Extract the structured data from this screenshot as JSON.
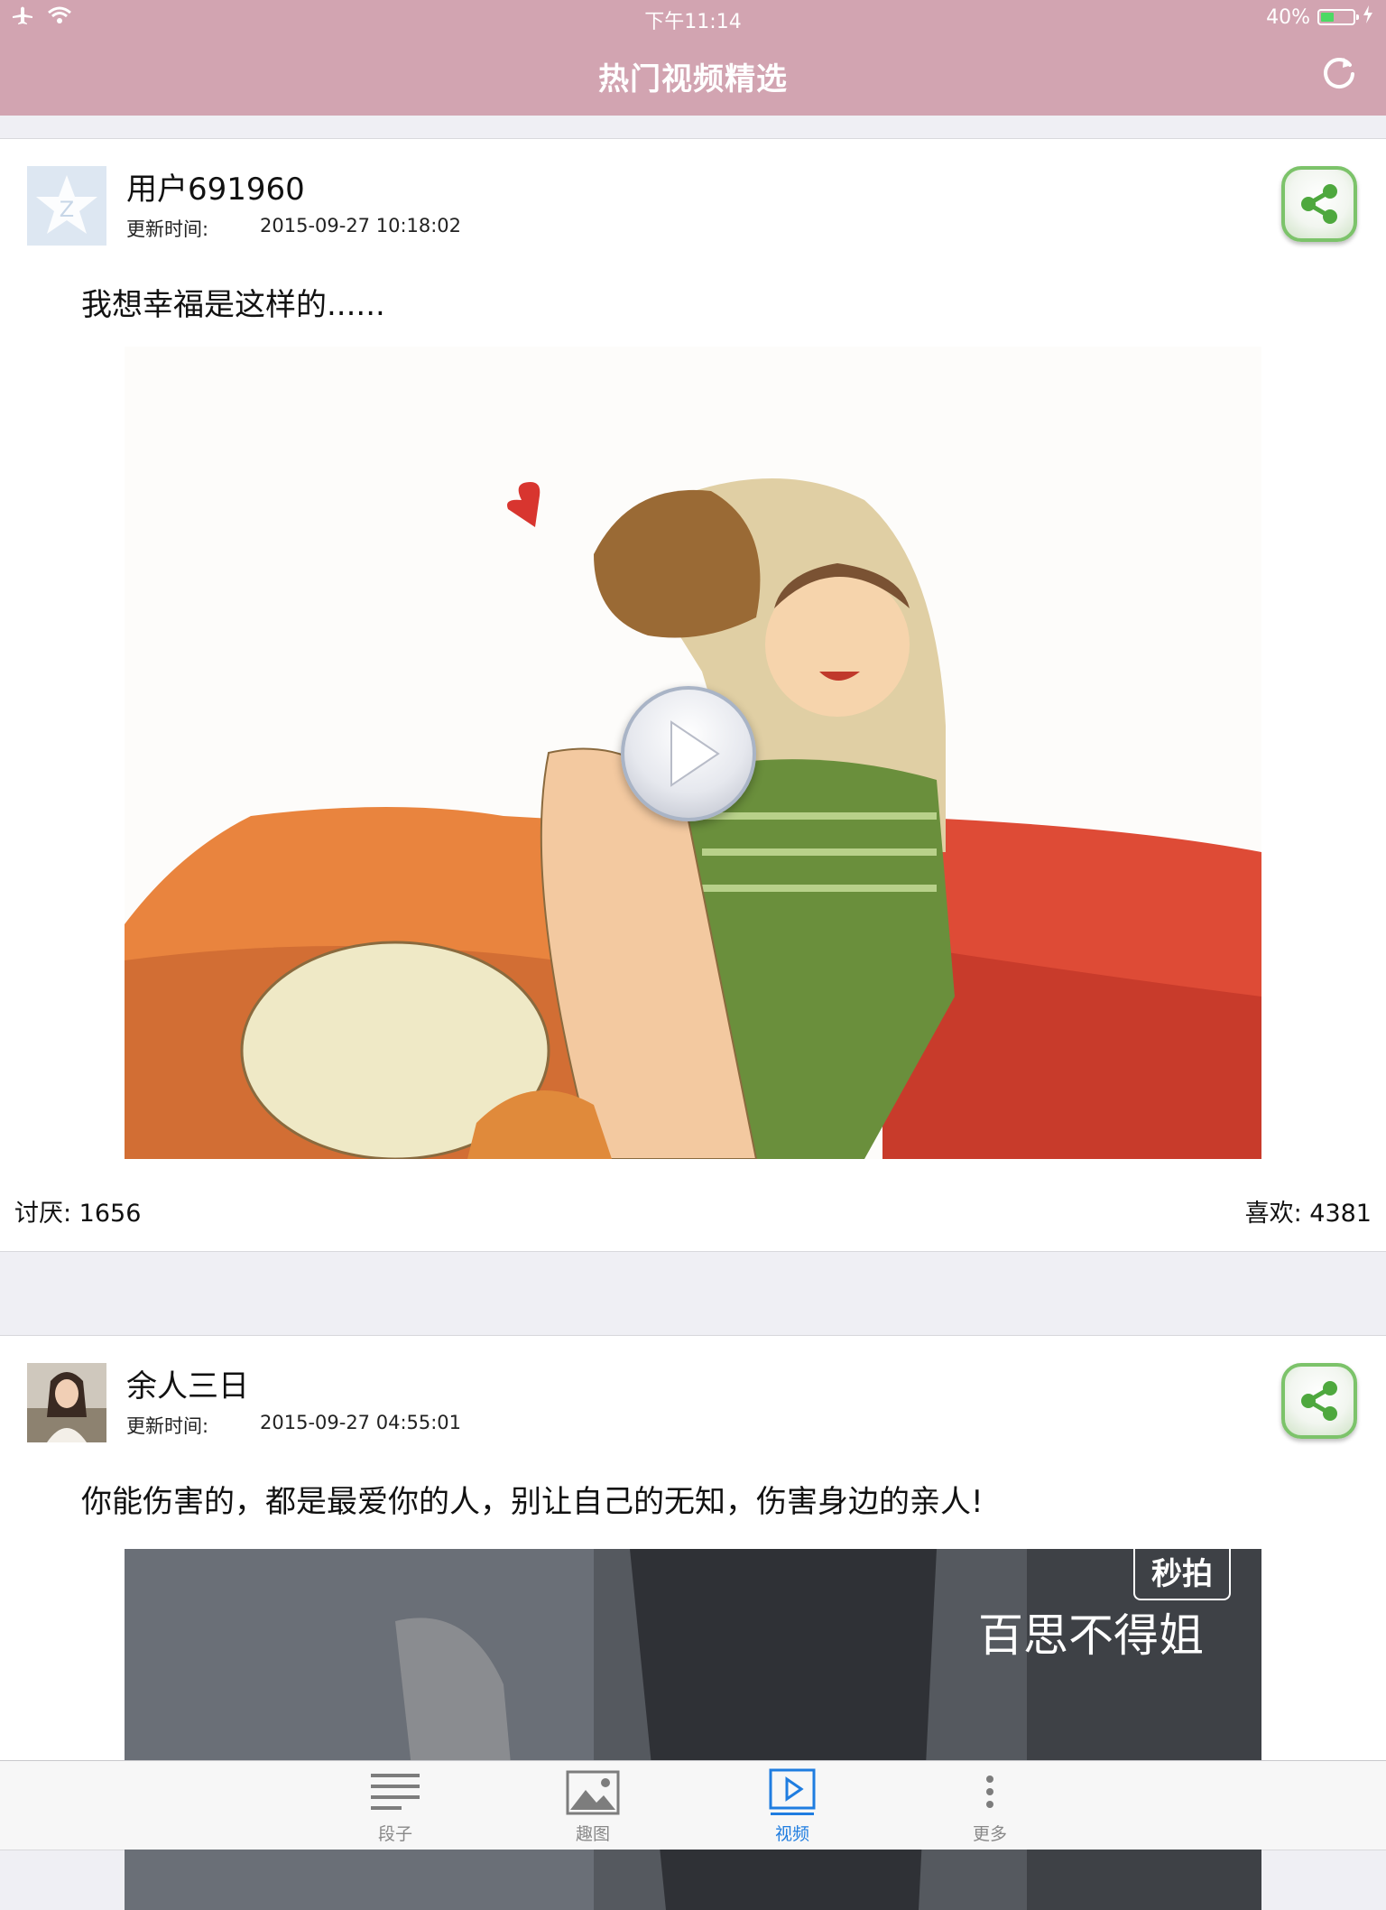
{
  "status": {
    "time": "下午11:14",
    "battery": "40%"
  },
  "nav": {
    "title": "热门视频精选"
  },
  "posts": [
    {
      "user": "用户691960",
      "updated_label": "更新时间:",
      "updated_time": "2015-09-27 10:18:02",
      "text": "我想幸福是这样的......",
      "dislike": "讨厌: 1656",
      "like": "喜欢: 4381"
    },
    {
      "user": "余人三日",
      "updated_label": "更新时间:",
      "updated_time": "2015-09-27 04:55:01",
      "text": "你能伤害的，都是最爱你的人，别让自己的无知，伤害身边的亲人!",
      "video_caption": "百思不得姐",
      "video_badge": "秒拍"
    }
  ],
  "tabs": [
    {
      "label": "段子",
      "icon": "list-icon",
      "active": false
    },
    {
      "label": "趣图",
      "icon": "image-icon",
      "active": false
    },
    {
      "label": "视频",
      "icon": "play-icon",
      "active": true
    },
    {
      "label": "更多",
      "icon": "more-icon",
      "active": false
    }
  ]
}
